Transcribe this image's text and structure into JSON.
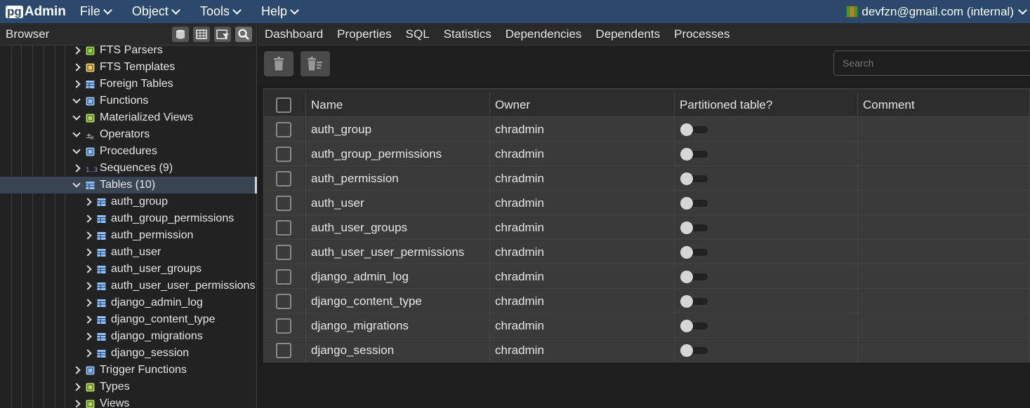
{
  "app": {
    "logo_pg": "pg",
    "logo_admin": "Admin"
  },
  "menu": [
    "File",
    "Object",
    "Tools",
    "Help"
  ],
  "user": {
    "label": "devfzn@gmail.com (internal)"
  },
  "browser": {
    "title": "Browser",
    "tree": [
      {
        "label": "FTS Parsers",
        "level": 1,
        "state": "collapsed",
        "icon": "fts-parser-icon",
        "selected": false
      },
      {
        "label": "FTS Templates",
        "level": 1,
        "state": "collapsed",
        "icon": "fts-template-icon",
        "selected": false
      },
      {
        "label": "Foreign Tables",
        "level": 1,
        "state": "collapsed",
        "icon": "foreign-table-icon",
        "selected": false
      },
      {
        "label": "Functions",
        "level": 1,
        "state": "expanded",
        "icon": "function-icon",
        "selected": false
      },
      {
        "label": "Materialized Views",
        "level": 1,
        "state": "expanded",
        "icon": "materialized-view-icon",
        "selected": false
      },
      {
        "label": "Operators",
        "level": 1,
        "state": "expanded",
        "icon": "operator-icon",
        "selected": false
      },
      {
        "label": "Procedures",
        "level": 1,
        "state": "expanded",
        "icon": "procedure-icon",
        "selected": false
      },
      {
        "label": "Sequences (9)",
        "level": 1,
        "state": "collapsed",
        "icon": "sequence-icon",
        "selected": false
      },
      {
        "label": "Tables (10)",
        "level": 1,
        "state": "expanded",
        "icon": "tables-icon",
        "selected": true
      },
      {
        "label": "auth_group",
        "level": 2,
        "state": "collapsed",
        "icon": "table-icon",
        "selected": false
      },
      {
        "label": "auth_group_permissions",
        "level": 2,
        "state": "collapsed",
        "icon": "table-icon",
        "selected": false
      },
      {
        "label": "auth_permission",
        "level": 2,
        "state": "collapsed",
        "icon": "table-icon",
        "selected": false
      },
      {
        "label": "auth_user",
        "level": 2,
        "state": "collapsed",
        "icon": "table-icon",
        "selected": false
      },
      {
        "label": "auth_user_groups",
        "level": 2,
        "state": "collapsed",
        "icon": "table-icon",
        "selected": false
      },
      {
        "label": "auth_user_user_permissions",
        "level": 2,
        "state": "collapsed",
        "icon": "table-icon",
        "selected": false
      },
      {
        "label": "django_admin_log",
        "level": 2,
        "state": "collapsed",
        "icon": "table-icon",
        "selected": false
      },
      {
        "label": "django_content_type",
        "level": 2,
        "state": "collapsed",
        "icon": "table-icon",
        "selected": false
      },
      {
        "label": "django_migrations",
        "level": 2,
        "state": "collapsed",
        "icon": "table-icon",
        "selected": false
      },
      {
        "label": "django_session",
        "level": 2,
        "state": "collapsed",
        "icon": "table-icon",
        "selected": false
      },
      {
        "label": "Trigger Functions",
        "level": 1,
        "state": "collapsed",
        "icon": "trigger-function-icon",
        "selected": false
      },
      {
        "label": "Types",
        "level": 1,
        "state": "collapsed",
        "icon": "type-icon",
        "selected": false
      },
      {
        "label": "Views",
        "level": 1,
        "state": "collapsed",
        "icon": "view-icon",
        "selected": false
      }
    ]
  },
  "tabs": [
    "Dashboard",
    "Properties",
    "SQL",
    "Statistics",
    "Dependencies",
    "Dependents",
    "Processes"
  ],
  "search": {
    "placeholder": "Search"
  },
  "grid": {
    "columns": [
      "Name",
      "Owner",
      "Partitioned table?",
      "Comment"
    ],
    "rows": [
      {
        "name": "auth_group",
        "owner": "chradmin",
        "partitioned": false,
        "comment": ""
      },
      {
        "name": "auth_group_permissions",
        "owner": "chradmin",
        "partitioned": false,
        "comment": ""
      },
      {
        "name": "auth_permission",
        "owner": "chradmin",
        "partitioned": false,
        "comment": ""
      },
      {
        "name": "auth_user",
        "owner": "chradmin",
        "partitioned": false,
        "comment": ""
      },
      {
        "name": "auth_user_groups",
        "owner": "chradmin",
        "partitioned": false,
        "comment": ""
      },
      {
        "name": "auth_user_user_permissions",
        "owner": "chradmin",
        "partitioned": false,
        "comment": ""
      },
      {
        "name": "django_admin_log",
        "owner": "chradmin",
        "partitioned": false,
        "comment": ""
      },
      {
        "name": "django_content_type",
        "owner": "chradmin",
        "partitioned": false,
        "comment": ""
      },
      {
        "name": "django_migrations",
        "owner": "chradmin",
        "partitioned": false,
        "comment": ""
      },
      {
        "name": "django_session",
        "owner": "chradmin",
        "partitioned": false,
        "comment": ""
      }
    ]
  },
  "colors": {
    "topbar": "#2b4a6b",
    "selected_row": "#3a4554",
    "table_icon": "#8fc3ff",
    "function_icon": "#e6c84a",
    "view_icon": "#b5e05a"
  }
}
